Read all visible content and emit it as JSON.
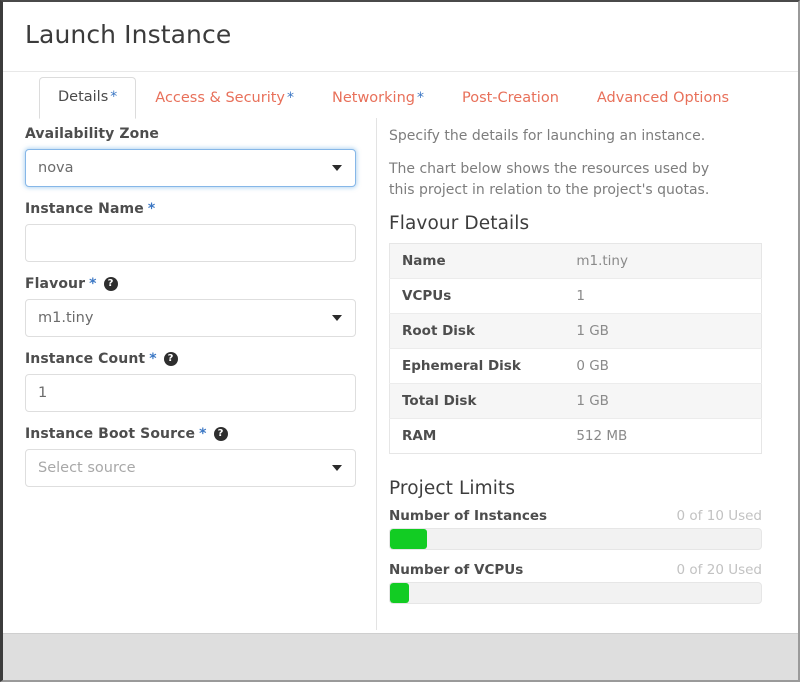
{
  "header": {
    "title": "Launch Instance"
  },
  "tabs": [
    {
      "label": "Details",
      "required": true,
      "active": true
    },
    {
      "label": "Access & Security",
      "required": true,
      "active": false
    },
    {
      "label": "Networking",
      "required": true,
      "active": false
    },
    {
      "label": "Post-Creation",
      "required": false,
      "active": false
    },
    {
      "label": "Advanced Options",
      "required": false,
      "active": false
    }
  ],
  "required_marker": "*",
  "help_glyph": "?",
  "form": {
    "availability_zone": {
      "label": "Availability Zone",
      "value": "nova",
      "required": false,
      "has_help": false,
      "type": "select",
      "focused": true
    },
    "instance_name": {
      "label": "Instance Name",
      "value": "",
      "placeholder": "",
      "required": true,
      "has_help": false,
      "type": "text"
    },
    "flavour": {
      "label": "Flavour",
      "value": "m1.tiny",
      "required": true,
      "has_help": true,
      "type": "select"
    },
    "instance_count": {
      "label": "Instance Count",
      "value": "1",
      "required": true,
      "has_help": true,
      "type": "text"
    },
    "instance_boot_source": {
      "label": "Instance Boot Source",
      "value": "Select source",
      "is_placeholder": true,
      "required": true,
      "has_help": true,
      "type": "select"
    }
  },
  "info": {
    "paragraph_1": "Specify the details for launching an instance.",
    "paragraph_2": "The chart below shows the resources used by this project in relation to the project's quotas."
  },
  "flavour_details": {
    "title": "Flavour Details",
    "rows": [
      {
        "key": "Name",
        "value": "m1.tiny"
      },
      {
        "key": "VCPUs",
        "value": "1"
      },
      {
        "key": "Root Disk",
        "value": "1 GB"
      },
      {
        "key": "Ephemeral Disk",
        "value": "0 GB"
      },
      {
        "key": "Total Disk",
        "value": "1 GB"
      },
      {
        "key": "RAM",
        "value": "512 MB"
      }
    ]
  },
  "project_limits": {
    "title": "Project Limits",
    "items": [
      {
        "name": "Number of Instances",
        "used_text": "0 of 10 Used",
        "used": 0,
        "total": 10,
        "bar_percent": 10
      },
      {
        "name": "Number of VCPUs",
        "used_text": "0 of 20 Used",
        "used": 0,
        "total": 20,
        "bar_percent": 5
      }
    ]
  },
  "colors": {
    "accent_tab": "#e8705a",
    "required_marker": "#3b77c4",
    "progress_green": "#12cc23",
    "focus_ring": "#86b7e8"
  }
}
